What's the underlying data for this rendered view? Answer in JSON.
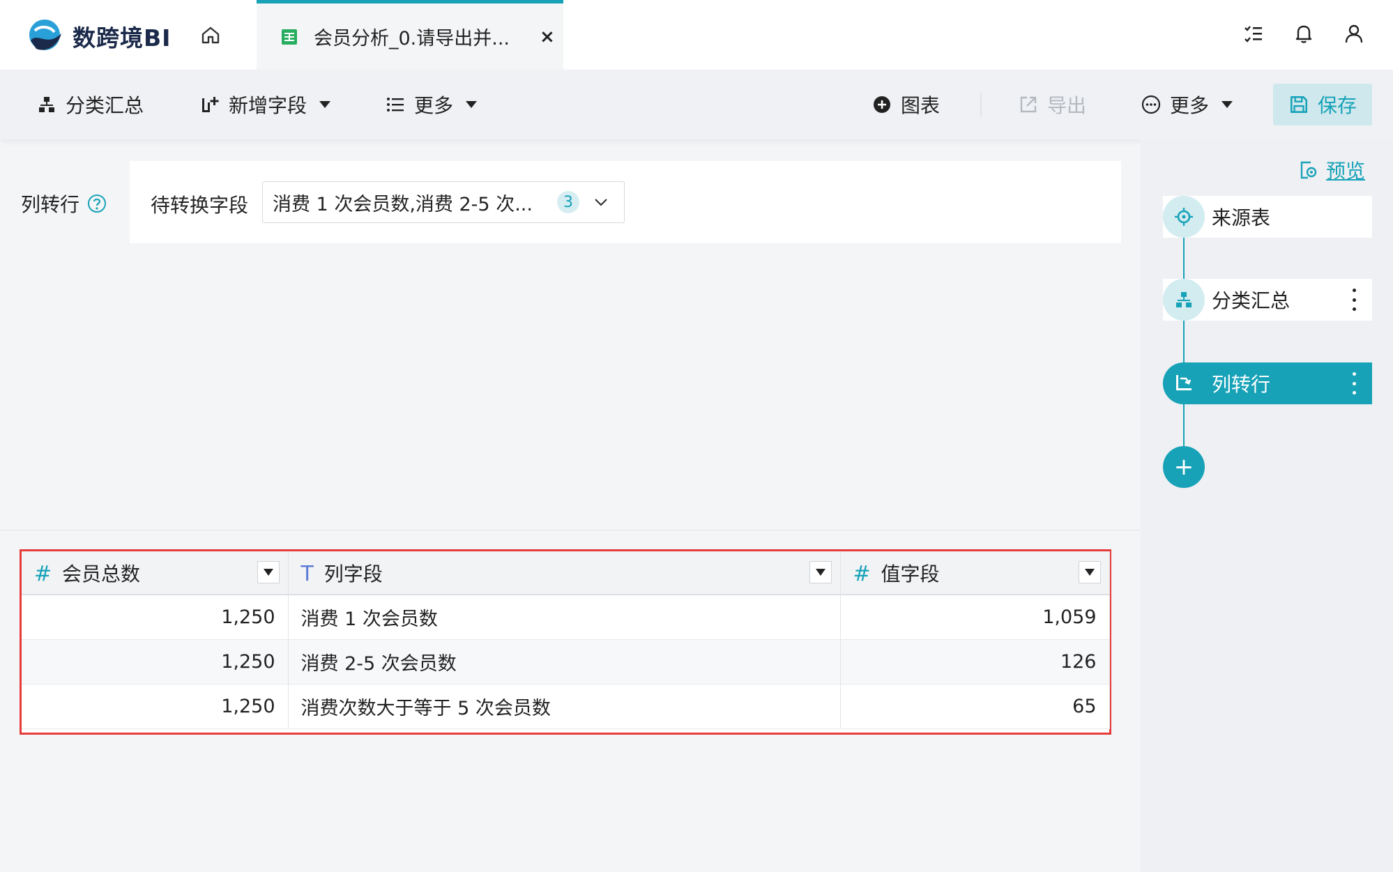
{
  "app": {
    "logo_text": "数跨境BI",
    "tab_title": "会员分析_0.请导出并...",
    "tab_close": "×"
  },
  "toolbar": {
    "group_summary": "分类汇总",
    "add_field": "新增字段",
    "more_left": "更多",
    "chart": "图表",
    "export": "导出",
    "more_right": "更多",
    "save": "保存"
  },
  "config": {
    "step_label": "列转行",
    "field_label": "待转换字段",
    "field_value": "消费 1 次会员数,消费 2-5 次...",
    "field_count": "3"
  },
  "table": {
    "columns": [
      {
        "type_symbol": "#",
        "name": "会员总数"
      },
      {
        "type_symbol": "T",
        "name": "列字段"
      },
      {
        "type_symbol": "#",
        "name": "值字段"
      }
    ],
    "rows": [
      {
        "total": "1,250",
        "column": "消费 1 次会员数",
        "value": "1,059"
      },
      {
        "total": "1,250",
        "column": "消费 2-5 次会员数",
        "value": "126"
      },
      {
        "total": "1,250",
        "column": "消费次数大于等于 5 次会员数",
        "value": "65"
      }
    ]
  },
  "flow": {
    "preview": "预览",
    "nodes": [
      {
        "label": "来源表"
      },
      {
        "label": "分类汇总"
      },
      {
        "label": "列转行"
      }
    ],
    "add_symbol": "+"
  },
  "colors": {
    "accent": "#17a2b8",
    "highlight_border": "#e63b3b",
    "background": "#f4f5f7"
  }
}
